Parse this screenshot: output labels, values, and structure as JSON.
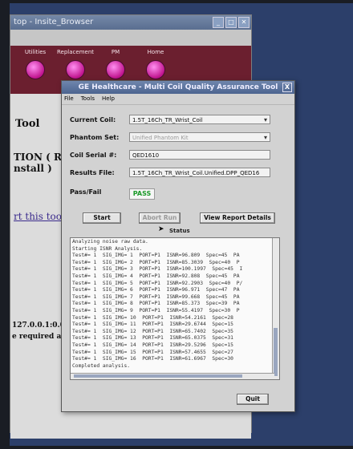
{
  "background_window": {
    "title": "top - Insite_Browser",
    "toolbar": [
      "Utilities",
      "Replacement",
      "PM",
      "Home"
    ],
    "heading_tool": "Tool",
    "heading_caution_1": "TION ( Re",
    "heading_caution_2": "nstall )",
    "link_text": "rt this tool",
    "ip_text": "127.0.0.1:0.0",
    "required_text": "e required a"
  },
  "dialog": {
    "title": "GE Healthcare - Multi Coil Quality Assurance Tool",
    "close_label": "X",
    "menu": [
      "File",
      "Tools",
      "Help"
    ],
    "fields": {
      "current_coil_label": "Current Coil:",
      "current_coil_value": "1.5T_16Ch_TR_Wrist_Coil",
      "phantom_set_label": "Phantom Set:",
      "phantom_set_value": "Unified Phantom Kit",
      "coil_serial_label": "Coil Serial #:",
      "coil_serial_value": "QED1610",
      "results_file_label": "Results File:",
      "results_file_value": "1.5T_16Ch_TR_Wrist_Coil.Unified.DPP_QED16",
      "pass_fail_label": "Pass/Fail",
      "pass_fail_value": "PASS"
    },
    "buttons": {
      "start": "Start",
      "abort": "Abort Run",
      "view_report": "View Report Details",
      "quit": "Quit"
    },
    "status_label": "Status",
    "log_lines": [
      "Analyzing noise raw data.",
      "Starting ISNR Analysis.",
      "Test#= 1  SIG_IMG= 1  PORT=P1  ISNR=96.809  Spec=45  PA",
      "Test#= 1  SIG_IMG= 2  PORT=P1  ISNR=85.3039  Spec=40  P",
      "Test#= 1  SIG_IMG= 3  PORT=P1  ISNR=100.1997  Spec=45  I",
      "Test#= 1  SIG_IMG= 4  PORT=P1  ISNR=92.808  Spec=45  PA",
      "Test#= 1  SIG_IMG= 5  PORT=P1  ISNR=92.2903  Spec=40  P/",
      "Test#= 1  SIG_IMG= 6  PORT=P1  ISNR=96.971  Spec=47  PA",
      "Test#= 1  SIG_IMG= 7  PORT=P1  ISNR=99.668  Spec=45  PA",
      "Test#= 1  SIG_IMG= 8  PORT=P1  ISNR=85.373  Spec=39  PA",
      "Test#= 1  SIG_IMG= 9  PORT=P1  ISNR=55.4197  Spec=30  P",
      "Test#= 1  SIG_IMG= 10  PORT=P1  ISNR=54.2161  Spec=28",
      "Test#= 1  SIG_IMG= 11  PORT=P1  ISNR=29.6744  Spec=15",
      "Test#= 1  SIG_IMG= 12  PORT=P1  ISNR=65.7402  Spec=35",
      "Test#= 1  SIG_IMG= 13  PORT=P1  ISNR=65.0375  Spec=31",
      "Test#= 1  SIG_IMG= 14  PORT=P1  ISNR=29.5296  Spec=15",
      "Test#= 1  SIG_IMG= 15  PORT=P1  ISNR=57.4655  Spec=27",
      "Test#= 1  SIG_IMG= 16  PORT=P1  ISNR=61.6967  Spec=30",
      "Completed analysis."
    ],
    "colors": {
      "pass": "#1c9a2a",
      "toolbar": "#6b1f2f",
      "titlebar": "#4c6490"
    }
  }
}
